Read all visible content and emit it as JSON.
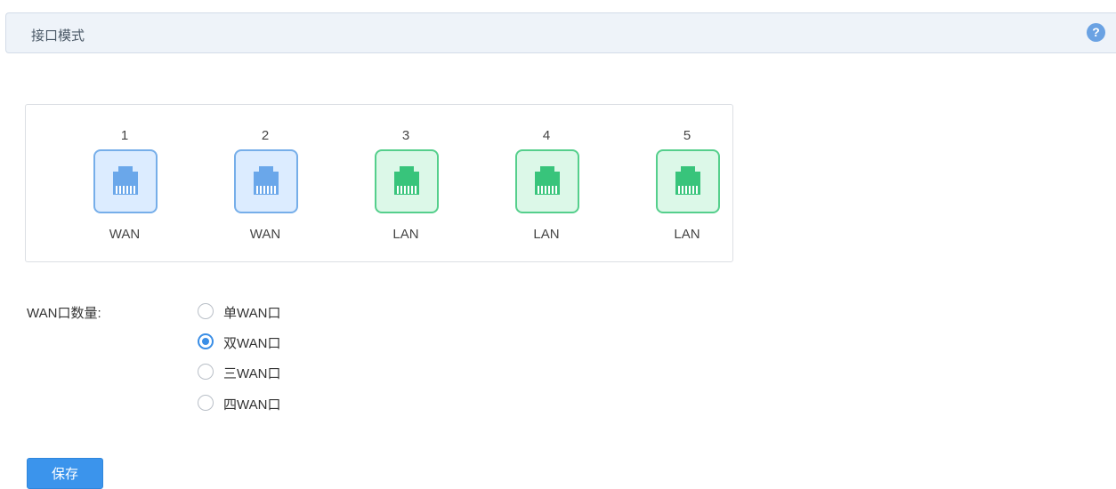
{
  "header": {
    "title": "接口模式",
    "help_icon": "question-icon",
    "help_symbol": "?"
  },
  "colors": {
    "wan": "#6aa7ea",
    "lan": "#38c47b",
    "accent": "#3b94ec"
  },
  "ports": [
    {
      "number": "1",
      "type": "WAN"
    },
    {
      "number": "2",
      "type": "WAN"
    },
    {
      "number": "3",
      "type": "LAN"
    },
    {
      "number": "4",
      "type": "LAN"
    },
    {
      "number": "5",
      "type": "LAN"
    }
  ],
  "wan_count": {
    "label": "WAN口数量:",
    "options": [
      {
        "label": "单WAN口",
        "checked": false
      },
      {
        "label": "双WAN口",
        "checked": true
      },
      {
        "label": "三WAN口",
        "checked": false
      },
      {
        "label": "四WAN口",
        "checked": false
      }
    ]
  },
  "actions": {
    "save_label": "保存"
  }
}
